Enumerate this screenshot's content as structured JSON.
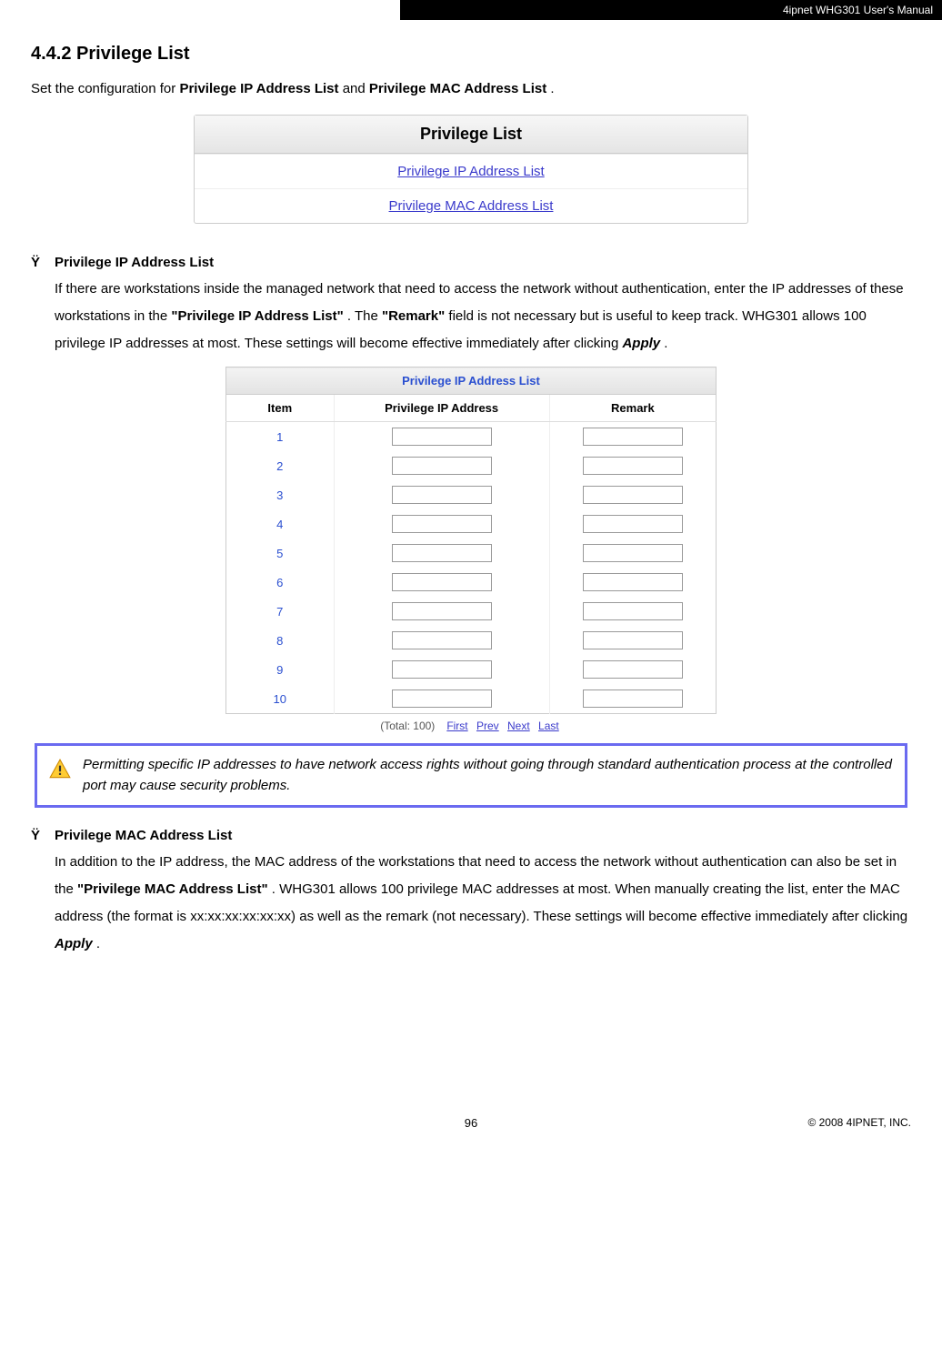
{
  "header": {
    "manual_title": "4ipnet WHG301 User's Manual"
  },
  "section": {
    "number_title": "4.4.2 Privilege List",
    "intro_pre": "Set the configuration for ",
    "intro_b1": "Privilege IP Address List",
    "intro_mid": " and ",
    "intro_b2": "Privilege MAC Address List",
    "intro_post": "."
  },
  "privilege_list_box": {
    "header": "Privilege List",
    "row1": "Privilege IP Address List",
    "row2": "Privilege MAC Address List"
  },
  "ip_section": {
    "bullet": "Ÿ",
    "title": "Privilege IP Address List",
    "body_1": "If there are workstations inside the managed network that need to access the network without authentication, enter the IP addresses of these workstations in the ",
    "body_b1": "\"Privilege IP Address List\"",
    "body_2": ". The ",
    "body_b2": "\"Remark\"",
    "body_3": " field is not necessary but is useful to keep track. WHG301 allows 100 privilege IP addresses at most. These settings will become effective immediately after clicking ",
    "body_apply": "Apply",
    "body_4": "."
  },
  "ip_table": {
    "main_header": "Privilege IP Address List",
    "col_item": "Item",
    "col_ip": "Privilege IP Address",
    "col_remark": "Remark",
    "rows": [
      "1",
      "2",
      "3",
      "4",
      "5",
      "6",
      "7",
      "8",
      "9",
      "10"
    ]
  },
  "pager": {
    "total": "(Total: 100)",
    "first": "First",
    "prev": "Prev",
    "next": "Next",
    "last": "Last"
  },
  "warning": {
    "text": "Permitting specific IP addresses to have network access rights without going through standard authentication process at the controlled port may cause security problems."
  },
  "mac_section": {
    "bullet": "Ÿ",
    "title": "Privilege MAC Address List",
    "body_1": "In addition to the IP address, the MAC address of the workstations that need to access the network without authentication can also be set in the ",
    "body_b1": "\"Privilege MAC Address List\"",
    "body_2": ". WHG301 allows 100 privilege MAC addresses at most. When manually creating the list, enter the MAC address (the format is xx:xx:xx:xx:xx:xx) as well as the remark (not necessary). These settings will become effective immediately after clicking ",
    "body_apply": "Apply",
    "body_3": "."
  },
  "footer": {
    "page": "96",
    "copyright": "© 2008 4IPNET, INC."
  }
}
